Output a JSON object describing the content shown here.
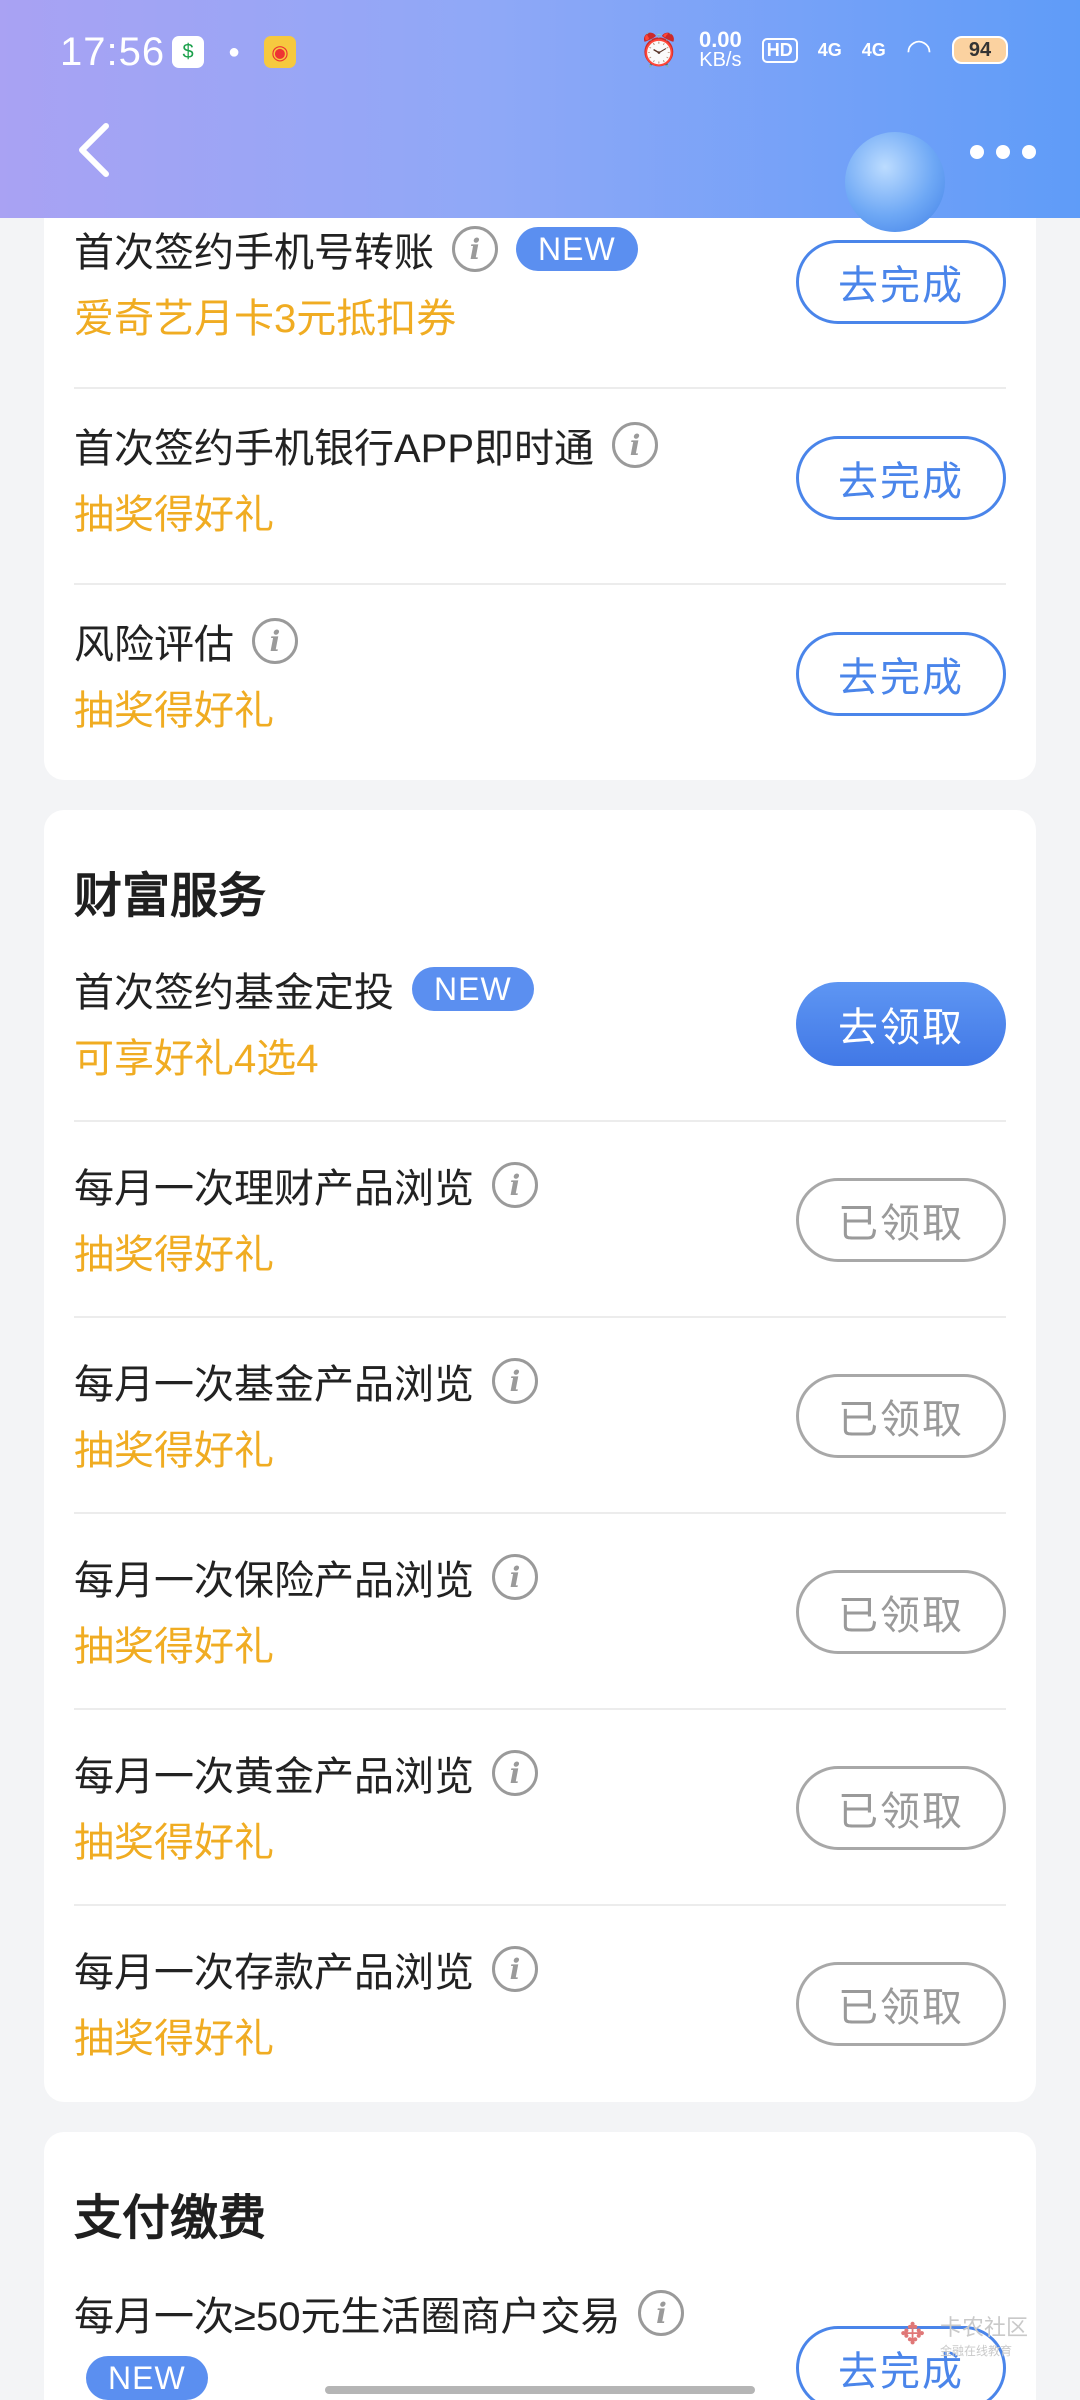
{
  "status_bar": {
    "time": "17:56",
    "net_speed_value": "0.00",
    "net_speed_unit": "KB/s",
    "hd": "HD",
    "signal1": "4G",
    "signal2": "4G",
    "battery": "94"
  },
  "header": {
    "back_icon": "chevron-left-icon",
    "more_icon": "more-dots-icon",
    "gradient_colors": [
      "#a9a2f3",
      "#5f9cf8"
    ]
  },
  "card1": {
    "rows": [
      {
        "title": "首次签约手机号转账",
        "badge": "NEW",
        "subtitle": "爱奇艺月卡3元抵扣券",
        "button": "去完成"
      },
      {
        "title": "首次签约手机银行APP即时通",
        "subtitle": "抽奖得好礼",
        "button": "去完成"
      },
      {
        "title": "风险评估",
        "subtitle": "抽奖得好礼",
        "button": "去完成"
      }
    ]
  },
  "card2": {
    "title": "财富服务",
    "rows": [
      {
        "title": "首次签约基金定投",
        "badge": "NEW",
        "subtitle": "可享好礼4选4",
        "button": "去领取"
      },
      {
        "title": "每月一次理财产品浏览",
        "subtitle": "抽奖得好礼",
        "button": "已领取"
      },
      {
        "title": "每月一次基金产品浏览",
        "subtitle": "抽奖得好礼",
        "button": "已领取"
      },
      {
        "title": "每月一次保险产品浏览",
        "subtitle": "抽奖得好礼",
        "button": "已领取"
      },
      {
        "title": "每月一次黄金产品浏览",
        "subtitle": "抽奖得好礼",
        "button": "已领取"
      },
      {
        "title": "每月一次存款产品浏览",
        "subtitle": "抽奖得好礼",
        "button": "已领取"
      }
    ]
  },
  "card3": {
    "title": "支付缴费",
    "rows": [
      {
        "title": "每月一次≥50元生活圈商户交易",
        "badge": "NEW",
        "button": "去完成"
      }
    ]
  },
  "watermark": {
    "name": "卡农社区",
    "tagline": "金融在线教育"
  },
  "colors": {
    "accent": "#4a85ea",
    "reward_text": "#f0ac22",
    "done_gray": "#9a9a9a"
  }
}
